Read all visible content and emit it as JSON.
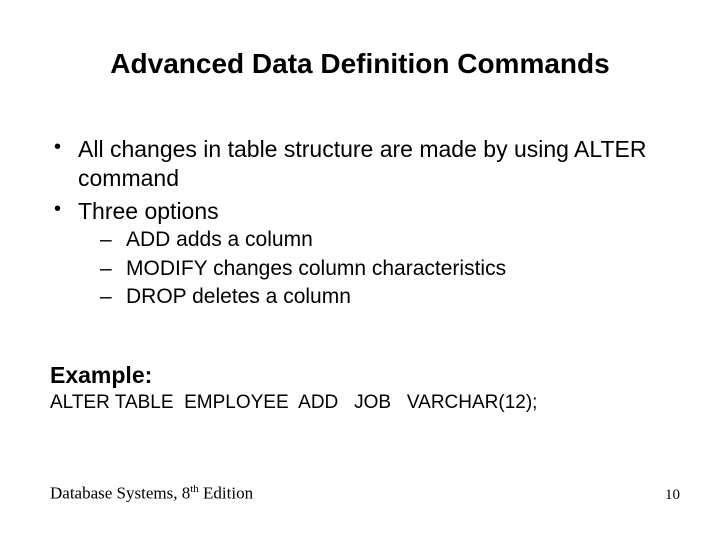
{
  "title": "Advanced Data Definition Commands",
  "bullets": [
    {
      "text": "All changes in table structure are made by using ALTER command"
    },
    {
      "text": "Three options",
      "sub": [
        "ADD adds a column",
        "MODIFY changes column characteristics",
        "DROP deletes a column"
      ]
    }
  ],
  "example_label": "Example:",
  "example_code": "ALTER TABLE  EMPLOYEE  ADD   JOB   VARCHAR(12);",
  "footer": {
    "text_prefix": "Database Systems, 8",
    "text_sup": "th",
    "text_suffix": " Edition",
    "page": "10"
  }
}
